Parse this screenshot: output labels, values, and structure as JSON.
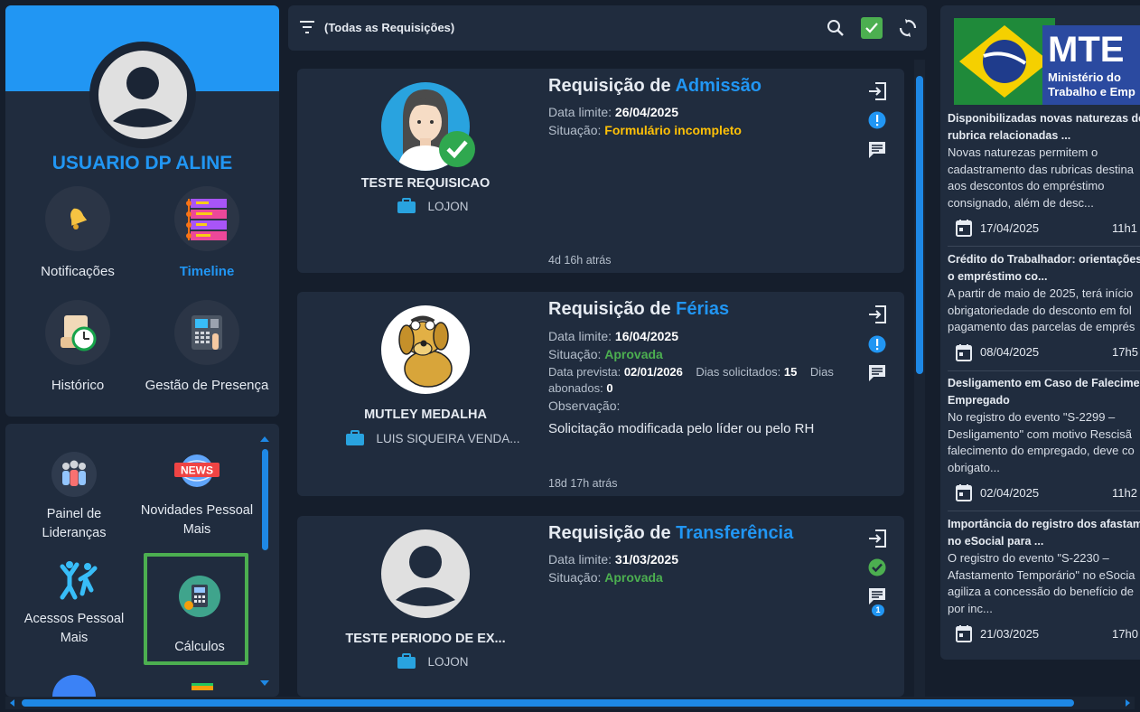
{
  "profile": {
    "name": "USUARIO DP ALINE",
    "tiles": [
      {
        "label": "Notificações",
        "icon": "bell-icon"
      },
      {
        "label": "Timeline",
        "icon": "timeline-icon",
        "active": true
      },
      {
        "label": "Histórico",
        "icon": "history-icon"
      },
      {
        "label": "Gestão de Presença",
        "icon": "time-clock-icon"
      }
    ]
  },
  "shortcuts": {
    "items": [
      {
        "label": "Painel de Lideranças",
        "icon": "team-icon"
      },
      {
        "label": "Novidades Pessoal Mais",
        "icon": "news-icon",
        "badge": "NEWS"
      },
      {
        "label": "Acessos Pessoal Mais",
        "icon": "people-jump-icon"
      },
      {
        "label": "Cálculos",
        "icon": "calculator-icon",
        "selected": true
      }
    ]
  },
  "toolbar": {
    "filter_label": "(Todas as Requisições)"
  },
  "requests": [
    {
      "title_prefix": "Requisição de",
      "kind": "Admissão",
      "person": "TESTE REQUISICAO",
      "company": "LOJON",
      "deadline_label": "Data limite:",
      "deadline": "26/04/2025",
      "status_label": "Situação:",
      "status": "Formulário incompleto",
      "ago": "4d 16h atrás"
    },
    {
      "title_prefix": "Requisição de",
      "kind": "Férias",
      "person": "MUTLEY MEDALHA",
      "company": "LUIS SIQUEIRA VENDA...",
      "deadline_label": "Data limite:",
      "deadline": "16/04/2025",
      "status_label": "Situação:",
      "status": "Aprovada",
      "expected_label": "Data prevista:",
      "expected": "02/01/2026",
      "requested_label": "Dias solicitados:",
      "requested": "15",
      "paid_label": "Dias abonados:",
      "paid": "0",
      "obs_label": "Observação:",
      "obs": "Solicitação modificada pelo líder ou pelo RH",
      "ago": "18d 17h atrás"
    },
    {
      "title_prefix": "Requisição de",
      "kind": "Transferência",
      "person": "TESTE PERIODO DE EX...",
      "company": "LOJON",
      "deadline_label": "Data limite:",
      "deadline": "31/03/2025",
      "status_label": "Situação:",
      "status": "Aprovada",
      "comment_count": "1"
    }
  ],
  "news": {
    "logo": {
      "abbr": "MTE",
      "line1": "Ministério do",
      "line2": "Trabalho e Emp"
    },
    "items": [
      {
        "title1": "Disponibilizadas novas naturezas de",
        "title2": "rubrica relacionadas ...",
        "d1": "Novas naturezas permitem o",
        "d2": "cadastramento das rubricas destina",
        "d3": "aos descontos do empréstimo",
        "d4": "consignado, além de desc...",
        "date": "17/04/2025",
        "time": "11h1"
      },
      {
        "title1": "Crédito do Trabalhador: orientações",
        "title2": "o empréstimo co...",
        "d1": "A partir de maio de 2025, terá início",
        "d2": "obrigatoriedade do desconto em fol",
        "d3": "pagamento das parcelas de emprés",
        "date": "08/04/2025",
        "time": "17h5"
      },
      {
        "title1": "Desligamento em Caso de Falecime",
        "title2": "Empregado",
        "d1": "No registro do evento \"S-2299 –",
        "d2": "Desligamento\" com motivo Rescisã",
        "d3": "falecimento do empregado, deve co",
        "d4": "obrigato...",
        "date": "02/04/2025",
        "time": "11h2"
      },
      {
        "title1": "Importância do registro dos afastam",
        "title2": "no eSocial para ...",
        "d1": "O registro do evento \"S-2230 –",
        "d2": "Afastamento Temporário\" no eSocia",
        "d3": "agiliza a concessão do benefício de",
        "d4": "por inc...",
        "date": "21/03/2025",
        "time": "17h0"
      }
    ]
  },
  "colors": {
    "accent": "#2196f3",
    "success": "#4caf50",
    "warning": "#ffc107",
    "panel": "#202c3e",
    "background": "#151e2c"
  }
}
